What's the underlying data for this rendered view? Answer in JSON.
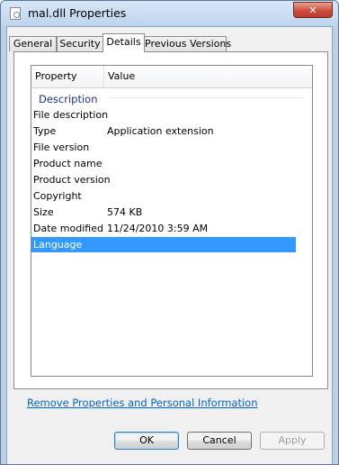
{
  "window": {
    "title": "mal.dll Properties",
    "close_symbol": "✕",
    "icon": "dll-file-icon"
  },
  "tabs": [
    {
      "label": "General",
      "active": false
    },
    {
      "label": "Security",
      "active": false
    },
    {
      "label": "Details",
      "active": true
    },
    {
      "label": "Previous Versions",
      "active": false
    }
  ],
  "details": {
    "header": {
      "property": "Property",
      "value": "Value"
    },
    "group_label": "Description",
    "rows": [
      {
        "property": "File description",
        "value": ""
      },
      {
        "property": "Type",
        "value": "Application extension"
      },
      {
        "property": "File version",
        "value": ""
      },
      {
        "property": "Product name",
        "value": ""
      },
      {
        "property": "Product version",
        "value": ""
      },
      {
        "property": "Copyright",
        "value": ""
      },
      {
        "property": "Size",
        "value": "574 KB"
      },
      {
        "property": "Date modified",
        "value": "11/24/2010 3:59 AM"
      },
      {
        "property": "Language",
        "value": "",
        "selected": true
      }
    ]
  },
  "remove_link": "Remove Properties and Personal Information",
  "buttons": {
    "ok": "OK",
    "cancel": "Cancel",
    "apply": "Apply"
  },
  "colors": {
    "selection": "#3399ff",
    "link": "#0066cc",
    "group_label": "#1e3287",
    "close_button": "#cf4d3d"
  }
}
